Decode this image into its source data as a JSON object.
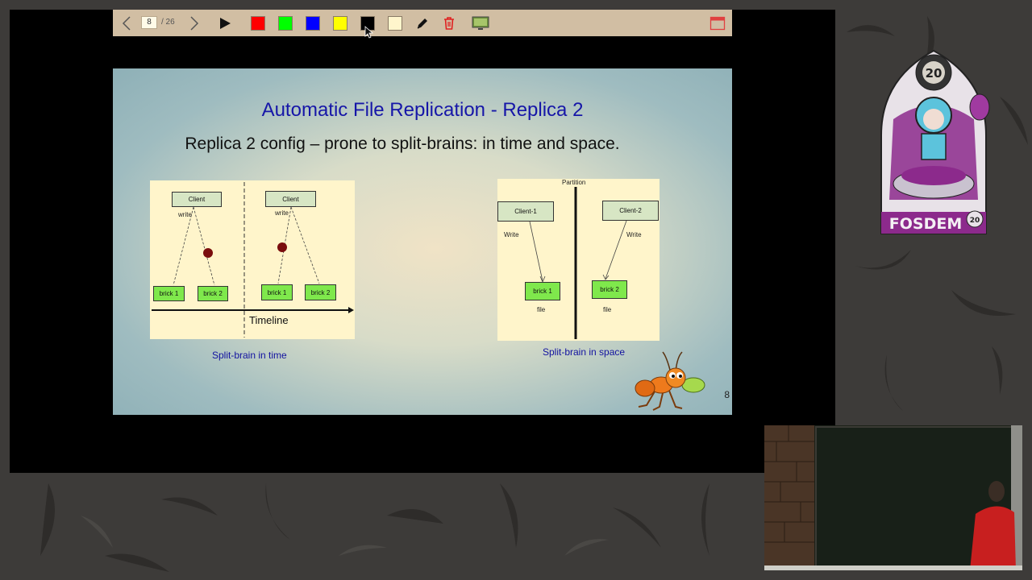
{
  "toolbar": {
    "current_page": "8",
    "total_pages": "/ 26",
    "icons": [
      "chevron-left-icon",
      "chevron-right-icon",
      "play-icon",
      "pen-icon",
      "trash-icon",
      "screen-icon",
      "minimize-icon"
    ],
    "colors": [
      "#ff0000",
      "#00ff00",
      "#0000ff",
      "#ffff00",
      "#000000",
      "#fff5cc"
    ]
  },
  "slide": {
    "title": "Automatic File Replication - Replica 2",
    "subtitle": "Replica 2 config – prone to split-brains: in time and space.",
    "page_number": "8",
    "left_diagram": {
      "client_label": "Client",
      "write_label": "write",
      "brick1_label": "brick 1",
      "brick2_label": "brick 2",
      "timeline_label": "Timeline",
      "caption": "Split-brain in time"
    },
    "right_diagram": {
      "partition_label": "Partition",
      "client1_label": "Client-1",
      "client2_label": "Client-2",
      "write_label": "Write",
      "brick1_label": "brick 1",
      "brick2_label": "brick 2",
      "file_label": "file",
      "caption": "Split-brain in space"
    }
  },
  "event_logo": {
    "year": "20",
    "name": "FOSDEM"
  }
}
